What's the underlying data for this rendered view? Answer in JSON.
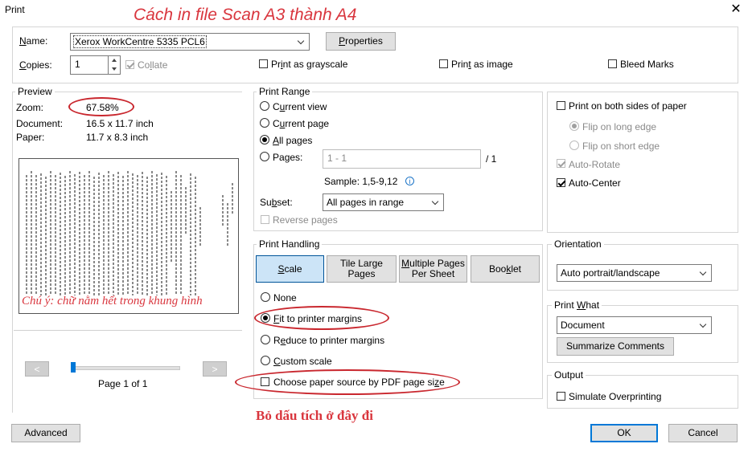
{
  "window": {
    "title": "Print",
    "close_glyph": "✕"
  },
  "annotations": {
    "heading": "Cách in file Scan A3 thành A4",
    "preview_note": "Chú ý: chữ nằm hết trong khung hình",
    "uncheck_note": "Bỏ dấu tích ở đây đi",
    "accent_color": "#d9363e"
  },
  "printer": {
    "name_label": "Name:",
    "name_value": "Xerox WorkCentre 5335 PCL6",
    "properties_label": "Properties",
    "copies_label": "Copies:",
    "copies_value": "1",
    "collate_label": "Collate",
    "grayscale_label": "Print as grayscale",
    "as_image_label": "Print as image",
    "bleed_label": "Bleed Marks"
  },
  "preview": {
    "legend": "Preview",
    "zoom_label": "Zoom:",
    "zoom_value": "67.58%",
    "document_label": "Document:",
    "document_value": "16.5 x 11.7 inch",
    "paper_label": "Paper:",
    "paper_value": "11.7 x 8.3 inch",
    "page_indicator": "Page 1 of 1",
    "prev_glyph": "<",
    "next_glyph": ">"
  },
  "print_range": {
    "legend": "Print Range",
    "current_view": "Current view",
    "current_page": "Current page",
    "all_pages": "All pages",
    "pages_label": "Pages:",
    "pages_value": "1 - 1",
    "pages_total": "/ 1",
    "sample": "Sample: 1,5-9,12",
    "subset_label": "Subset:",
    "subset_value": "All pages in range",
    "reverse_pages": "Reverse pages"
  },
  "duplex": {
    "both_sides": "Print on both sides of paper",
    "long_edge": "Flip on long edge",
    "short_edge": "Flip on short edge",
    "auto_rotate": "Auto-Rotate",
    "auto_center": "Auto-Center"
  },
  "print_handling": {
    "legend": "Print Handling",
    "tabs": [
      "Scale",
      "Tile Large Pages",
      "Multiple Pages Per Sheet",
      "Booklet"
    ],
    "none": "None",
    "fit": "Fit to printer margins",
    "reduce": "Reduce to printer margins",
    "custom": "Custom scale",
    "paper_source": "Choose paper source by PDF page size"
  },
  "orientation": {
    "legend": "Orientation",
    "value": "Auto portrait/landscape"
  },
  "print_what": {
    "legend": "Print What",
    "value": "Document",
    "summarize": "Summarize Comments"
  },
  "output": {
    "legend": "Output",
    "simulate": "Simulate Overprinting"
  },
  "footer": {
    "advanced": "Advanced",
    "ok": "OK",
    "cancel": "Cancel"
  }
}
